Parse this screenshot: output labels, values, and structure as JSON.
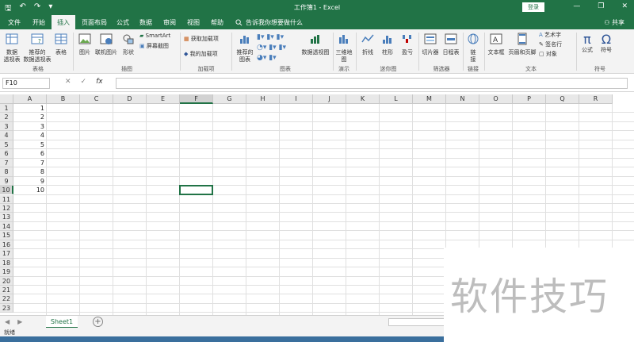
{
  "titlebar": {
    "title": "工作簿1  -  Excel",
    "login_label": "登录",
    "qat": {
      "save": "🖫",
      "undo": "↶",
      "redo": "↷",
      "more": "▾"
    },
    "win": {
      "min": "—",
      "restore": "❐",
      "close": "✕"
    }
  },
  "tabs": {
    "items": [
      "文件",
      "开始",
      "插入",
      "页面布局",
      "公式",
      "数据",
      "审阅",
      "视图",
      "帮助"
    ],
    "active": "插入",
    "tellme": "告诉我你想要做什么",
    "share": "共享"
  },
  "ribbon": {
    "tables": {
      "pivot": "数据\n透视表",
      "recommended": "推荐的\n数据透视表",
      "table": "表格",
      "label": "表格"
    },
    "illustrations": {
      "picture": "图片",
      "online_picture": "联机图片",
      "shapes": "形状",
      "smartart": "SmartArt",
      "screenshot": "屏幕截图",
      "label": "插图"
    },
    "addins": {
      "get": "获取加载项",
      "my": "我的加载项",
      "label": "加载项"
    },
    "charts": {
      "recommended": "推荐的\n图表",
      "pivot_chart": "数据透视图",
      "label": "图表"
    },
    "tours": {
      "map3d": "三维地\n图",
      "label": "演示"
    },
    "sparklines": {
      "line": "折线",
      "column": "柱形",
      "winloss": "盈亏",
      "label": "迷你图"
    },
    "filters": {
      "slicer": "切片器",
      "timeline": "日程表",
      "label": "筛选器"
    },
    "links": {
      "link": "链\n接",
      "label": "链接"
    },
    "text": {
      "textbox": "文本框",
      "header_footer": "页眉和页脚",
      "wordart": "艺术字",
      "signature": "签名行",
      "object": "对象",
      "label": "文本"
    },
    "symbols": {
      "equation": "公式",
      "symbol": "符号",
      "label": "符号"
    }
  },
  "formulabar": {
    "namebox": "F10",
    "cancel": "✕",
    "enter": "✓",
    "fx": "fx",
    "value": ""
  },
  "grid": {
    "columns": [
      "A",
      "B",
      "C",
      "D",
      "E",
      "F",
      "G",
      "H",
      "I",
      "J",
      "K",
      "L",
      "M",
      "N",
      "O",
      "P",
      "Q",
      "R"
    ],
    "rows": [
      "1",
      "2",
      "3",
      "4",
      "5",
      "6",
      "7",
      "8",
      "9",
      "10",
      "11",
      "12",
      "13",
      "14",
      "15",
      "16",
      "17",
      "18",
      "19",
      "20",
      "21",
      "22",
      "23"
    ],
    "colA_values": [
      "1",
      "2",
      "3",
      "4",
      "5",
      "6",
      "7",
      "8",
      "9",
      "10"
    ],
    "selected_cell": "F10"
  },
  "sheets": {
    "tabs": [
      "Sheet1"
    ],
    "active": "Sheet1",
    "add": "+"
  },
  "status": {
    "text": "就绪"
  },
  "watermark": "软件技巧",
  "colors": {
    "brand": "#217346",
    "ribbon_bg": "#f3f3f3"
  }
}
